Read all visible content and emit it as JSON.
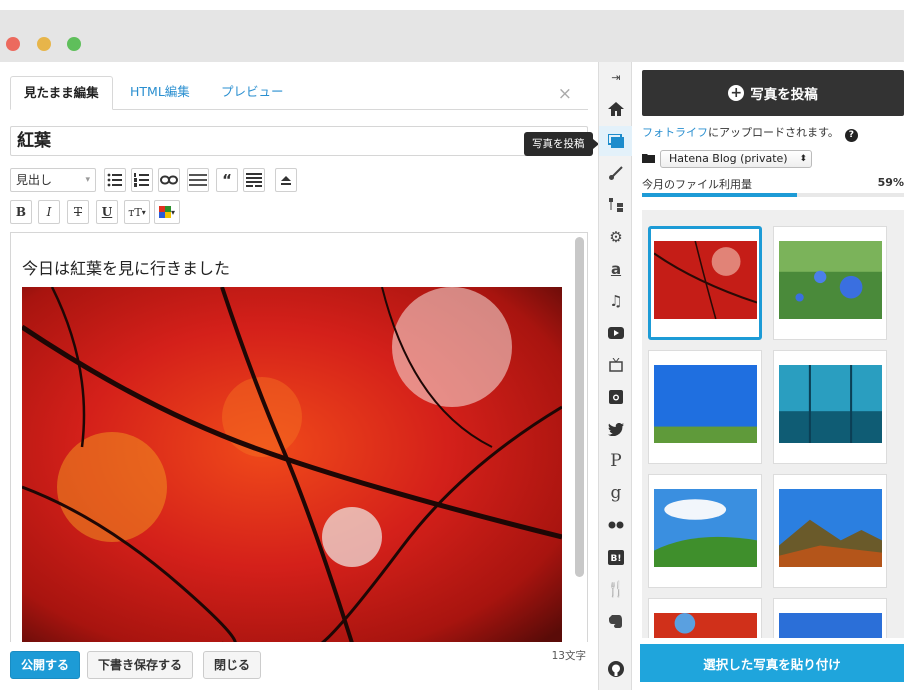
{
  "window": {
    "traffic_lights": [
      "close",
      "minimize",
      "zoom"
    ]
  },
  "editor": {
    "tabs": [
      {
        "label": "見たまま編集",
        "active": true
      },
      {
        "label": "HTML編集",
        "active": false
      },
      {
        "label": "プレビュー",
        "active": false
      }
    ],
    "close_label": "×",
    "title_value": "紅葉",
    "heading_select": "見出し",
    "body_text": "今日は紅葉を見に行きました",
    "toolbar_row2": {
      "bold": "B",
      "italic": "I",
      "strike": "T",
      "underline": "U",
      "fontsize": "тT"
    },
    "char_count": "13文字",
    "buttons": {
      "publish": "公開する",
      "draft": "下書き保存する",
      "close": "閉じる"
    }
  },
  "strip": {
    "tooltip": "写真を投稿",
    "icons": [
      "collapse-icon",
      "home-icon",
      "photo-icon",
      "brush-icon",
      "tree-icon",
      "gear-icon",
      "amazon-icon",
      "music-icon",
      "youtube-icon",
      "tv-icon",
      "instagram-icon",
      "twitter-icon",
      "pinterest-icon",
      "google-icon",
      "flickr-icon",
      "hatena-bookmark-icon",
      "restaurant-icon",
      "evernote-icon",
      "github-icon"
    ]
  },
  "panel": {
    "post_button": "写真を投稿",
    "upload_link": "フォトライフ",
    "upload_note": "にアップロードされます。",
    "help": "?",
    "album": "Hatena Blog (private)",
    "album_arrows": "⬍",
    "usage_label": "今月のファイル利用量",
    "usage_percent": "59%",
    "usage_value": 0.59,
    "paste_button": "選択した写真を貼り付け"
  },
  "colors": {
    "accent": "#1d9bd6",
    "dark_button": "#333333",
    "link": "#2a8fd0"
  }
}
